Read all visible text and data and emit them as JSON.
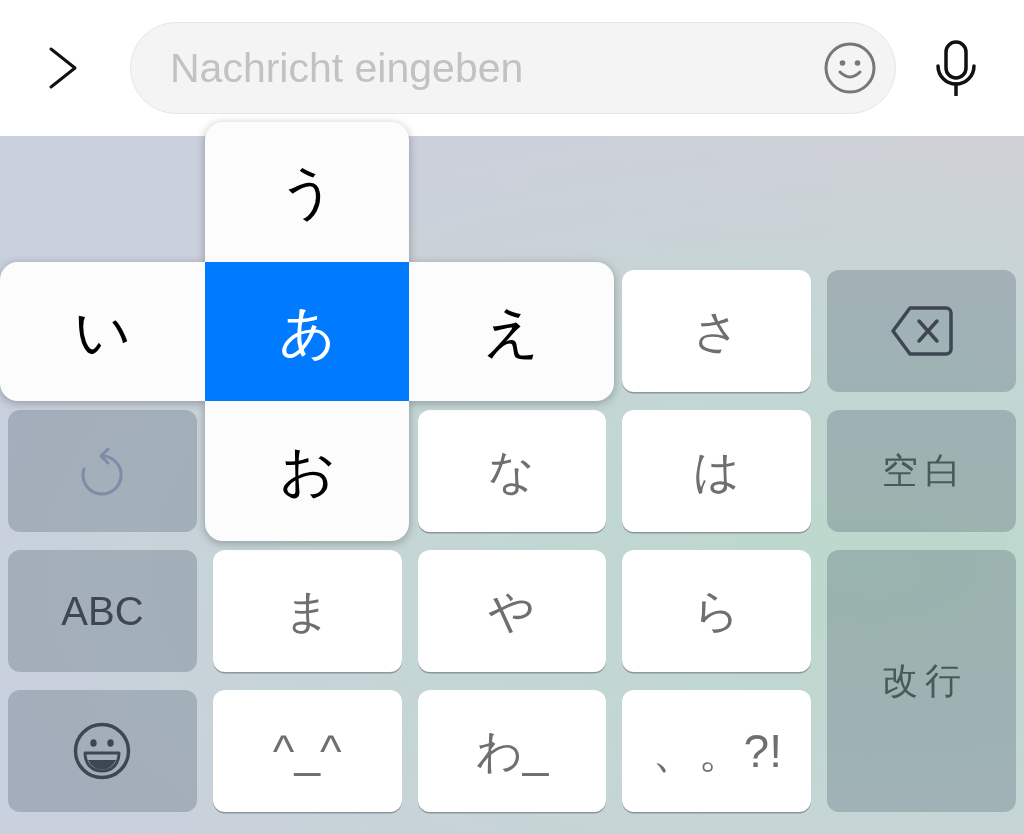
{
  "top_bar": {
    "message_field": {
      "placeholder": "Nachricht eingeben"
    }
  },
  "flick_popup": {
    "options": [
      {
        "label": "う",
        "selected": false
      },
      {
        "label": "い",
        "selected": false
      },
      {
        "label": "あ",
        "selected": true
      },
      {
        "label": "え",
        "selected": false
      },
      {
        "label": "お",
        "selected": false
      }
    ]
  },
  "keyboard": {
    "rows": [
      [
        "",
        "",
        "",
        {
          "kind": "kana",
          "label": "さ",
          "disabled": false
        },
        {
          "kind": "delete",
          "disabled": false
        }
      ],
      [
        {
          "kind": "undo",
          "disabled": true
        },
        "",
        {
          "kind": "kana",
          "label": "な",
          "disabled": false
        },
        {
          "kind": "kana",
          "label": "は",
          "disabled": false
        },
        {
          "kind": "space",
          "label": "空白",
          "disabled": false
        }
      ],
      [
        {
          "kind": "mode",
          "label": "ABC",
          "disabled": false
        },
        {
          "kind": "kana",
          "label": "ま",
          "disabled": false
        },
        {
          "kind": "kana",
          "label": "や",
          "disabled": false
        },
        {
          "kind": "kana",
          "label": "ら",
          "disabled": false
        },
        {
          "kind": "return",
          "label": "改行",
          "disabled": false
        }
      ],
      [
        {
          "kind": "emoji",
          "disabled": false
        },
        {
          "kind": "kana",
          "label": "^_^",
          "disabled": false
        },
        {
          "kind": "kana",
          "label": "わ_",
          "disabled": false
        },
        {
          "kind": "kana",
          "label": "、。?!",
          "disabled": false
        }
      ]
    ]
  }
}
